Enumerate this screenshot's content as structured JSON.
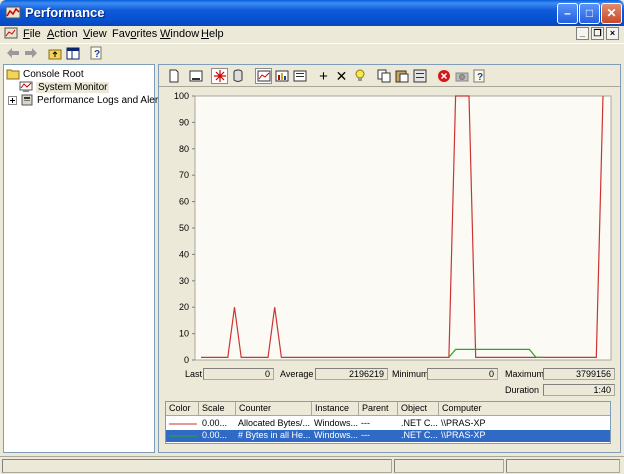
{
  "window": {
    "title": "Performance"
  },
  "menu": {
    "items": [
      {
        "label": "File",
        "accel": "F"
      },
      {
        "label": "Action",
        "accel": "A"
      },
      {
        "label": "View",
        "accel": "V"
      },
      {
        "label": "Favorites",
        "accel": "o"
      },
      {
        "label": "Window",
        "accel": "W"
      },
      {
        "label": "Help",
        "accel": "H"
      }
    ]
  },
  "tree": {
    "root": "Console Root",
    "items": [
      {
        "label": "System Monitor",
        "selected": true
      },
      {
        "label": "Performance Logs and Alerts",
        "selected": false
      }
    ]
  },
  "chart_data": {
    "type": "line",
    "ylim": [
      0,
      100
    ],
    "yticks": [
      "0",
      "10",
      "20",
      "30",
      "40",
      "50",
      "60",
      "70",
      "80",
      "90",
      "100"
    ],
    "grid": false,
    "series": [
      {
        "color": "#cc3333",
        "values": [
          1,
          1,
          1,
          1,
          1,
          20,
          1,
          1,
          1,
          1,
          1,
          20,
          1,
          1,
          1,
          1,
          1,
          1,
          1,
          1,
          1,
          1,
          1,
          1,
          1,
          1,
          1,
          1,
          1,
          1,
          1,
          1,
          1,
          1,
          1,
          1,
          1,
          1,
          100,
          100,
          100,
          1,
          1,
          1,
          1,
          1,
          1,
          1,
          1,
          1,
          1,
          1,
          1,
          1,
          1,
          1,
          1,
          1,
          1,
          1,
          100
        ]
      },
      {
        "color": "#22aa22",
        "values": [
          null,
          null,
          null,
          null,
          null,
          null,
          null,
          null,
          null,
          null,
          null,
          null,
          null,
          null,
          null,
          null,
          null,
          null,
          null,
          null,
          null,
          null,
          null,
          null,
          null,
          null,
          null,
          null,
          null,
          null,
          null,
          null,
          null,
          null,
          null,
          null,
          null,
          1,
          4,
          4,
          4,
          4,
          4,
          4,
          4,
          4,
          4,
          4,
          4,
          4,
          1,
          1,
          null,
          null,
          null,
          null,
          null,
          null,
          null,
          null,
          null
        ]
      }
    ]
  },
  "stats": {
    "last_label": "Last",
    "last": "0",
    "average_label": "Average",
    "average": "2196219",
    "minimum_label": "Minimum",
    "minimum": "0",
    "maximum_label": "Maximum",
    "maximum": "3799156",
    "duration_label": "Duration",
    "duration": "1:40"
  },
  "counters": {
    "headers": [
      "Color",
      "Scale",
      "Counter",
      "Instance",
      "Parent",
      "Object",
      "Computer"
    ],
    "rows": [
      {
        "color": "#cc3333",
        "scale": "0.00...",
        "counter": "Allocated Bytes/...",
        "instance": "Windows...",
        "parent": "---",
        "object": ".NET C...",
        "computer": "\\\\PRAS-XP",
        "selected": false
      },
      {
        "color": "#22aa22",
        "scale": "0.00...",
        "counter": "# Bytes in all He...",
        "instance": "Windows...",
        "parent": "---",
        "object": ".NET C...",
        "computer": "\\\\PRAS-XP",
        "selected": true
      }
    ]
  },
  "colors": {
    "titlebar": "#0550d0",
    "selection": "#316ac5",
    "chart_bg": "#fcfaf4"
  }
}
